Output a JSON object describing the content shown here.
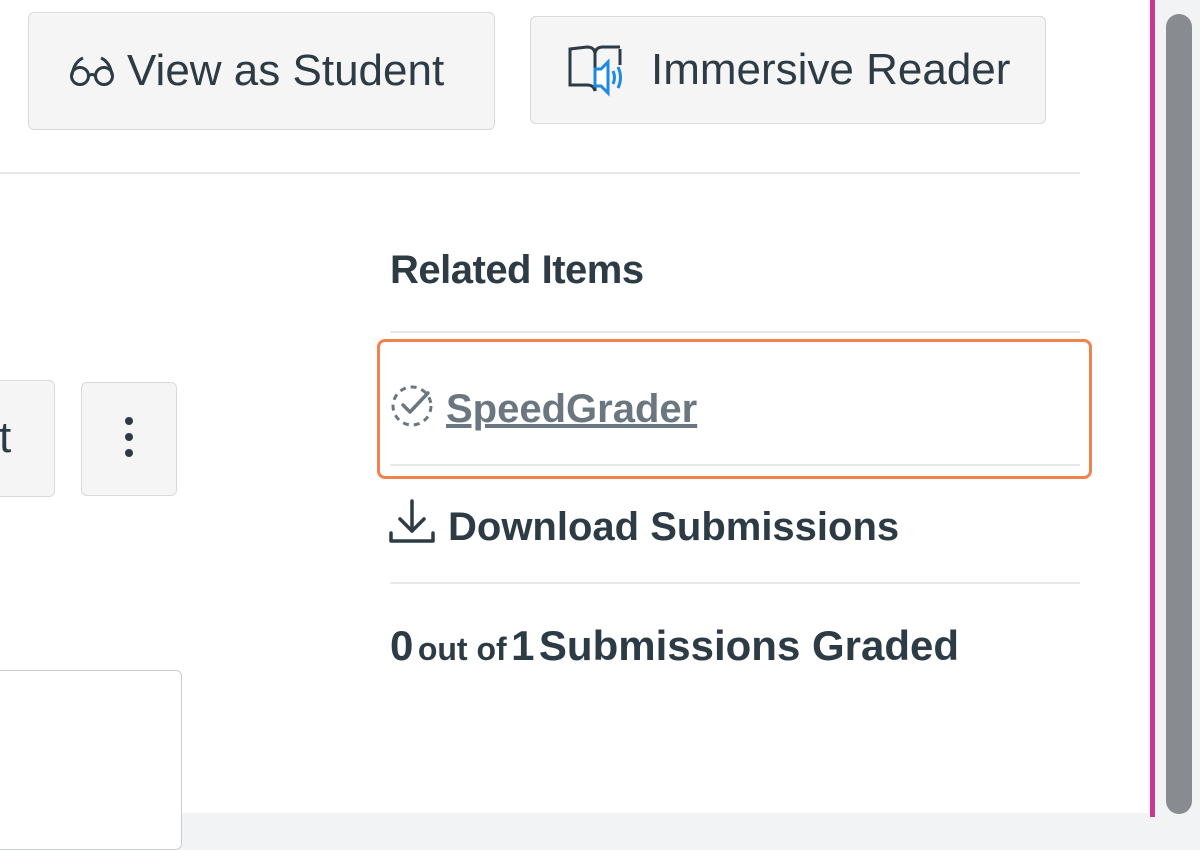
{
  "toolbar": {
    "view_as_student": "View as Student",
    "immersive_reader": "Immersive Reader"
  },
  "left_controls": {
    "partial_button_text": "t"
  },
  "related_items": {
    "title": "Related Items",
    "speedgrader": "SpeedGrader",
    "download_submissions": "Download Submissions"
  },
  "grading": {
    "graded_count": "0",
    "out_of": "out of",
    "total": "1",
    "submissions_graded": "Submissions Graded"
  },
  "icons": {
    "view_as_student": "glasses-icon",
    "immersive_reader": "book-speaker-icon",
    "speedgrader": "dashed-circle-check-icon",
    "download": "download-arrow-icon",
    "more": "kebab-menu-icon"
  },
  "colors": {
    "highlight_border": "#f0824f",
    "accent_line": "#c7398f",
    "reader_icon_blue": "#1e88e5",
    "link_gray": "#6b7780",
    "text": "#2d3b45"
  }
}
